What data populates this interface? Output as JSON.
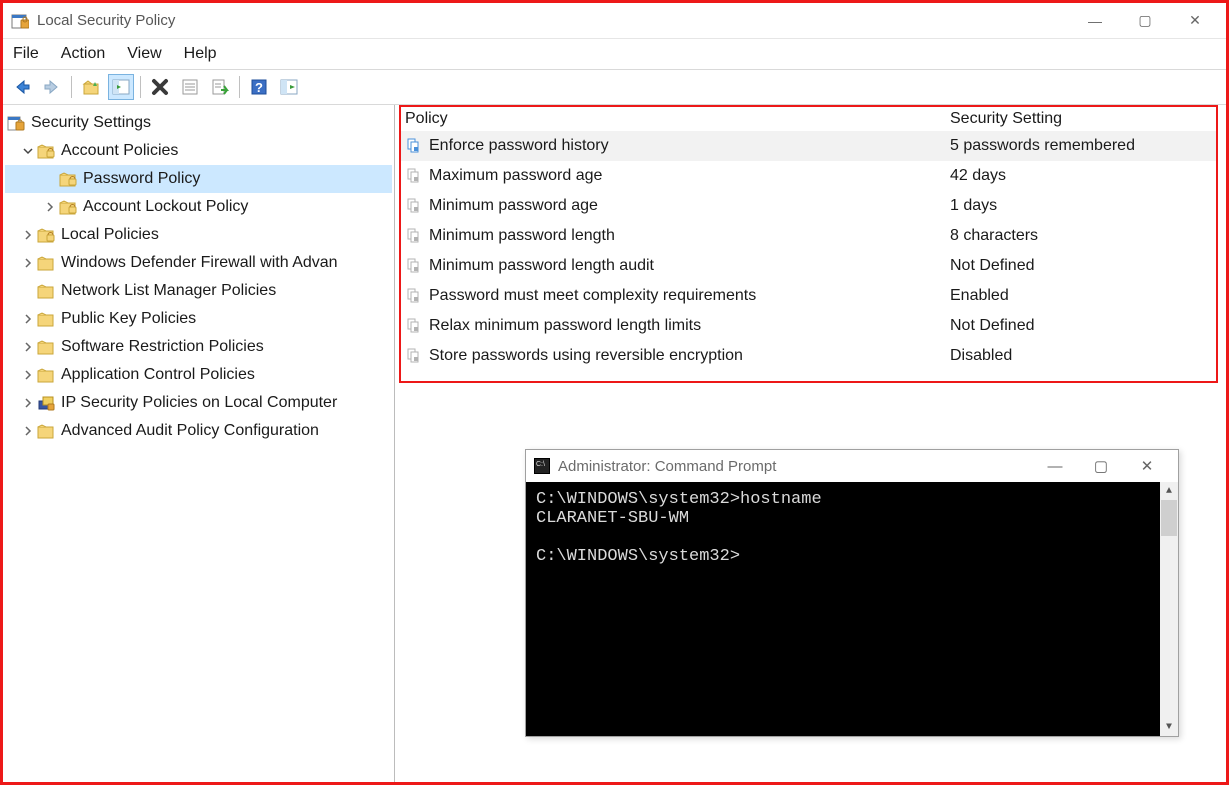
{
  "window": {
    "title": "Local Security Policy",
    "controls": {
      "min": "—",
      "max": "▢",
      "close": "✕"
    }
  },
  "menu": [
    "File",
    "Action",
    "View",
    "Help"
  ],
  "tree": {
    "root_label": "Security Settings",
    "items": [
      {
        "label": "Account Policies",
        "expanded": true,
        "children": [
          {
            "label": "Password Policy",
            "selected": true
          },
          {
            "label": "Account Lockout Policy",
            "expandable": true
          }
        ]
      },
      {
        "label": "Local Policies",
        "expandable": true
      },
      {
        "label": "Windows Defender Firewall with Advan",
        "expandable": true
      },
      {
        "label": "Network List Manager Policies"
      },
      {
        "label": "Public Key Policies",
        "expandable": true
      },
      {
        "label": "Software Restriction Policies",
        "expandable": true
      },
      {
        "label": "Application Control Policies",
        "expandable": true
      },
      {
        "label": "IP Security Policies on Local Computer",
        "expandable": true,
        "icon": "ipsec"
      },
      {
        "label": "Advanced Audit Policy Configuration",
        "expandable": true
      }
    ]
  },
  "policy_headers": {
    "policy": "Policy",
    "setting": "Security Setting"
  },
  "policies": [
    {
      "name": "Enforce password history",
      "value": "5 passwords remembered",
      "selected": true
    },
    {
      "name": "Maximum password age",
      "value": "42 days"
    },
    {
      "name": "Minimum password age",
      "value": "1 days"
    },
    {
      "name": "Minimum password length",
      "value": "8 characters"
    },
    {
      "name": "Minimum password length audit",
      "value": "Not Defined"
    },
    {
      "name": "Password must meet complexity requirements",
      "value": "Enabled"
    },
    {
      "name": "Relax minimum password length limits",
      "value": "Not Defined"
    },
    {
      "name": "Store passwords using reversible encryption",
      "value": "Disabled"
    }
  ],
  "cmd": {
    "title": "Administrator: Command Prompt",
    "lines": [
      "C:\\WINDOWS\\system32>hostname",
      "CLARANET-SBU-WM",
      "",
      "C:\\WINDOWS\\system32>"
    ],
    "controls": {
      "min": "—",
      "max": "▢",
      "close": "✕"
    }
  }
}
